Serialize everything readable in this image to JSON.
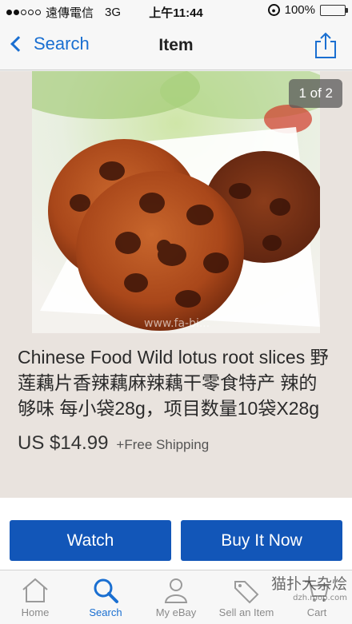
{
  "status_bar": {
    "carrier": "遠傳電信",
    "network": "3G",
    "time": "上午11:44",
    "battery": "100%",
    "battery_level": 1.0
  },
  "nav": {
    "back_label": "Search",
    "title": "Item"
  },
  "gallery": {
    "counter": "1 of 2",
    "photo_watermark": "www.fa-bi..."
  },
  "item": {
    "title": "Chinese Food Wild lotus root slices 野莲藕片香辣藕麻辣藕干零食特产 辣的够味 每小袋28g，项目数量10袋X28g",
    "price": "US $14.99",
    "shipping": "+Free Shipping"
  },
  "actions": {
    "watch_label": "Watch",
    "buy_label": "Buy It Now"
  },
  "tabs": [
    {
      "label": "Home",
      "icon": "home-icon"
    },
    {
      "label": "Search",
      "icon": "search-icon"
    },
    {
      "label": "My eBay",
      "icon": "person-icon"
    },
    {
      "label": "Sell an Item",
      "icon": "tag-icon"
    },
    {
      "label": "Cart",
      "icon": "cart-icon"
    }
  ],
  "overlay_watermark": {
    "text": "猫扑大杂烩",
    "url": "dzh.mop.com"
  },
  "colors": {
    "accent": "#1a6fd1",
    "button": "#1256b8",
    "battery": "#3fcf3f"
  }
}
